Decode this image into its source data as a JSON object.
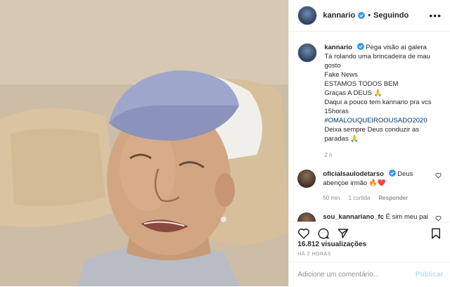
{
  "header": {
    "username": "kannario",
    "separator": "•",
    "follow_status": "Seguindo",
    "more_label": "•••"
  },
  "caption": {
    "username": "kannario",
    "lines": [
      "Pega visão aí galera",
      "Tá rolando uma brincadeira de mau gosto",
      "Fake News",
      "ESTAMOS TODOS BEM",
      "Graças A DEUS 🙏",
      "Daqui a pouco tem kannario pra vcs 15horas",
      "#OMALOUQUEIROOUSADO2020",
      "Deixa sempre Deus conduzir as paradas 🙏"
    ],
    "time": "2 h"
  },
  "comments": [
    {
      "username": "oficialsaulodetarso",
      "text": "Deus abençoe irmão 🔥❤️",
      "time": "50 min",
      "likes": "1 curtida",
      "reply": "Responder"
    },
    {
      "username": "sou_kannariano_fc",
      "text": "É sim meu pai",
      "time": "",
      "likes": "",
      "reply": ""
    }
  ],
  "actions": {
    "icons": [
      "heart-icon",
      "comment-icon",
      "share-icon",
      "bookmark-icon"
    ]
  },
  "views": "16.812 visualizações",
  "posted_ago": "HÁ 2 HORAS",
  "add_comment": {
    "placeholder": "Adicione um comentário...",
    "publish": "Publicar"
  },
  "colors": {
    "verified": "#3897f0",
    "link": "#00376b",
    "muted": "#8e8e8e",
    "publish_disabled": "#b2dffc"
  }
}
